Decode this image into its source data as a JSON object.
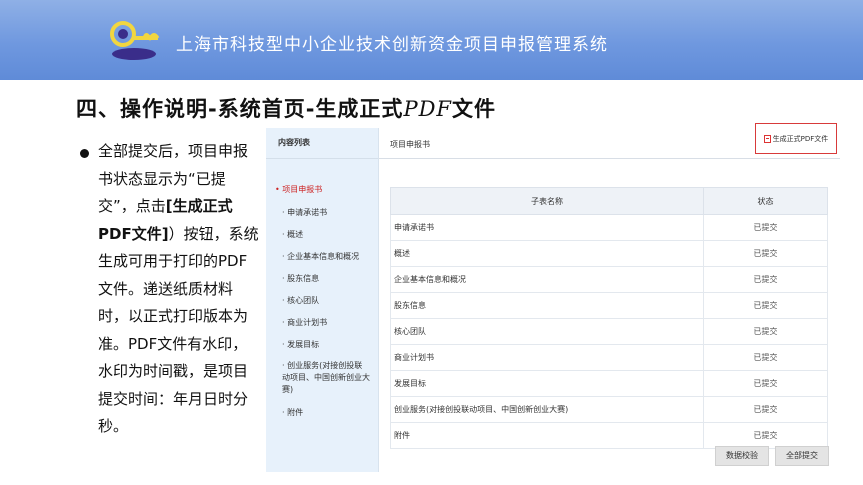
{
  "banner": {
    "title": "上海市科技型中小企业技术创新资金项目申报管理系统"
  },
  "slide": {
    "title_prefix": "四、操作说明-系统首页-生成正式",
    "title_pdf": "PDF",
    "title_suffix": "文件"
  },
  "bullet": {
    "part1": "全部提交后，项目申报书状态显示为“已提交”，点击",
    "bold": "[生成正式PDF文件]",
    "part2": "）按钮，系统生成可用于打印的PDF文件。递送纸质材料时，以正式打印版本为准。PDF文件有水印，水印为时间戳，是项目提交时间：年月日时分秒。"
  },
  "app": {
    "sidebar": {
      "header": "内容列表",
      "active": "项目申报书",
      "items": [
        "申请承诺书",
        "概述",
        "企业基本信息和概况",
        "股东信息",
        "核心团队",
        "商业计划书",
        "发展目标",
        "创业服务(对接创投联动项目、中国创新创业大赛)",
        "附件"
      ]
    },
    "main_header": "项目申报书",
    "generate_button": "生成正式PDF文件",
    "table": {
      "headers": [
        "子表名称",
        "状态"
      ],
      "rows": [
        [
          "申请承诺书",
          "已提交"
        ],
        [
          "概述",
          "已提交"
        ],
        [
          "企业基本信息和概况",
          "已提交"
        ],
        [
          "股东信息",
          "已提交"
        ],
        [
          "核心团队",
          "已提交"
        ],
        [
          "商业计划书",
          "已提交"
        ],
        [
          "发展目标",
          "已提交"
        ],
        [
          "创业服务(对接创投联动项目、中国创新创业大赛)",
          "已提交"
        ],
        [
          "附件",
          "已提交"
        ]
      ]
    },
    "buttons": {
      "validate": "数据校验",
      "submit_all": "全部提交"
    }
  }
}
